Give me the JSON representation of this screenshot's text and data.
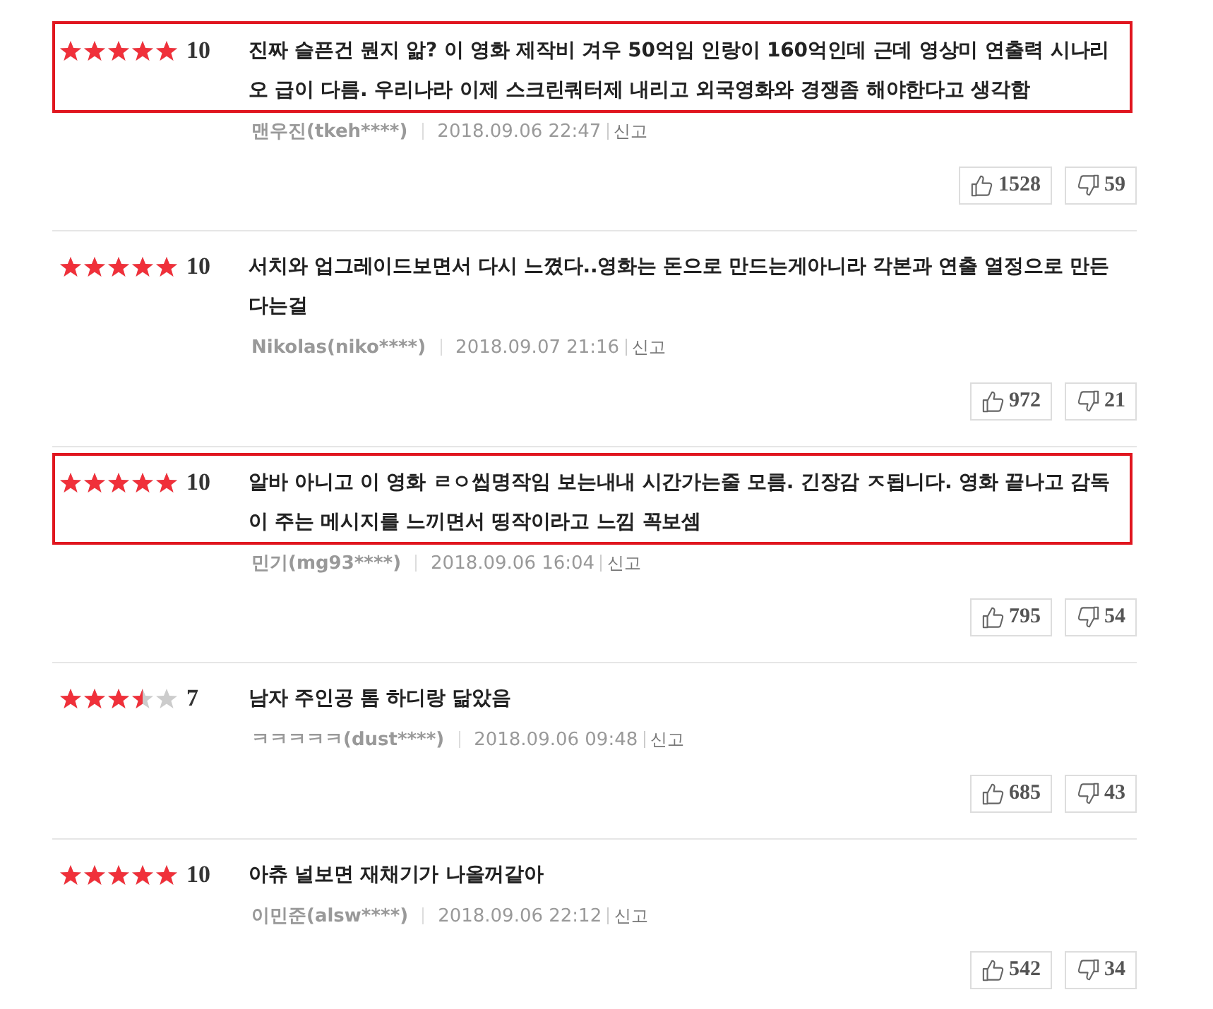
{
  "reviews": [
    {
      "stars": 5,
      "score": "10",
      "highlighted": true,
      "text": "진짜 슬픈건 뭔지 앎? 이 영화 제작비 겨우 50억임 인랑이 160억인데 근데 영상미 연출력 시나리오 급이 다름. 우리나라 이제 스크린쿼터제 내리고 외국영화와 경쟁좀 해야한다고 생각함",
      "author": "맨우진(tkeh****)",
      "date": "2018.09.06 22:47",
      "report": "신고",
      "likes": "1528",
      "dislikes": "59"
    },
    {
      "stars": 5,
      "score": "10",
      "highlighted": false,
      "text": "서치와 업그레이드보면서 다시 느꼈다..영화는 돈으로 만드는게아니라 각본과 연출 열정으로 만든다는걸",
      "author": "Nikolas(niko****)",
      "date": "2018.09.07 21:16",
      "report": "신고",
      "likes": "972",
      "dislikes": "21"
    },
    {
      "stars": 5,
      "score": "10",
      "highlighted": true,
      "text": "알바 아니고 이 영화 ㄹㅇ씹명작임 보는내내 시간가는줄 모름. 긴장감 ㅈ됩니다. 영화 끝나고 감독이 주는 메시지를 느끼면서 띵작이라고 느낌 꼭보셈",
      "author": "민기(mg93****)",
      "date": "2018.09.06 16:04",
      "report": "신고",
      "likes": "795",
      "dislikes": "54"
    },
    {
      "stars": 3.5,
      "score": "7",
      "highlighted": false,
      "text": "남자 주인공 톰 하디랑 닮았음",
      "author": "ㅋㅋㅋㅋㅋ(dust****)",
      "date": "2018.09.06 09:48",
      "report": "신고",
      "likes": "685",
      "dislikes": "43"
    },
    {
      "stars": 5,
      "score": "10",
      "highlighted": false,
      "text": "아츄 널보면 재채기가 나올꺼같아",
      "author": "이민준(alsw****)",
      "date": "2018.09.06 22:12",
      "report": "신고",
      "likes": "542",
      "dislikes": "34"
    }
  ]
}
